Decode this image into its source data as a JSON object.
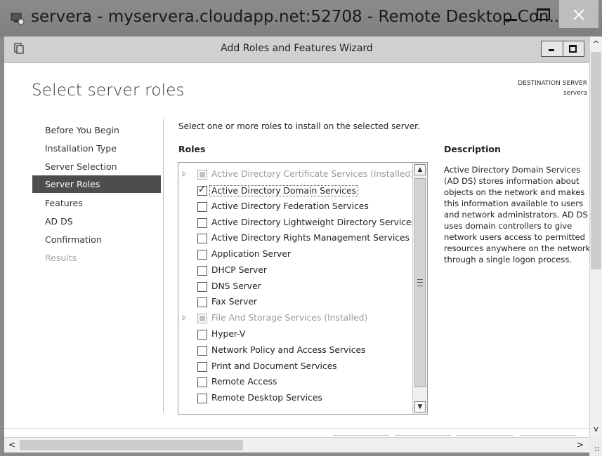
{
  "rdp": {
    "title": "servera - myservera.cloudapp.net:52708 - Remote Desktop Con..."
  },
  "wizard": {
    "title": "Add Roles and Features Wizard",
    "page_title": "Select server roles",
    "destination_label": "DESTINATION SERVER",
    "destination_value": "servera",
    "instruction": "Select one or more roles to install on the selected server.",
    "roles_heading": "Roles",
    "description_heading": "Description",
    "description": "Active Directory Domain Services (AD DS) stores information about objects on the network and makes this information available to users and network administrators. AD DS uses domain controllers to give network users access to permitted resources anywhere on the network through a single logon process."
  },
  "nav": [
    {
      "label": "Before You Begin",
      "state": "normal"
    },
    {
      "label": "Installation Type",
      "state": "normal"
    },
    {
      "label": "Server Selection",
      "state": "normal"
    },
    {
      "label": "Server Roles",
      "state": "active"
    },
    {
      "label": "Features",
      "state": "normal"
    },
    {
      "label": "AD DS",
      "state": "normal"
    },
    {
      "label": "Confirmation",
      "state": "normal"
    },
    {
      "label": "Results",
      "state": "disabled"
    }
  ],
  "roles": [
    {
      "label": "Active Directory Certificate Services (Installed)",
      "checked": false,
      "installed": true,
      "expandable": true
    },
    {
      "label": "Active Directory Domain Services",
      "checked": true,
      "installed": false,
      "expandable": false,
      "selected": true
    },
    {
      "label": "Active Directory Federation Services",
      "checked": false,
      "installed": false,
      "expandable": false
    },
    {
      "label": "Active Directory Lightweight Directory Services",
      "checked": false,
      "installed": false,
      "expandable": false
    },
    {
      "label": "Active Directory Rights Management Services",
      "checked": false,
      "installed": false,
      "expandable": false
    },
    {
      "label": "Application Server",
      "checked": false,
      "installed": false,
      "expandable": false
    },
    {
      "label": "DHCP Server",
      "checked": false,
      "installed": false,
      "expandable": false
    },
    {
      "label": "DNS Server",
      "checked": false,
      "installed": false,
      "expandable": false
    },
    {
      "label": "Fax Server",
      "checked": false,
      "installed": false,
      "expandable": false
    },
    {
      "label": "File And Storage Services (Installed)",
      "checked": false,
      "installed": true,
      "expandable": true
    },
    {
      "label": "Hyper-V",
      "checked": false,
      "installed": false,
      "expandable": false
    },
    {
      "label": "Network Policy and Access Services",
      "checked": false,
      "installed": false,
      "expandable": false
    },
    {
      "label": "Print and Document Services",
      "checked": false,
      "installed": false,
      "expandable": false
    },
    {
      "label": "Remote Access",
      "checked": false,
      "installed": false,
      "expandable": false
    },
    {
      "label": "Remote Desktop Services",
      "checked": false,
      "installed": false,
      "expandable": false
    }
  ],
  "colors": {
    "nav_active_bg": "#4d4d4d",
    "rdp_titlebar": "#8c8c8c",
    "close_button": "#bdbdbd",
    "disabled_text": "#9a9a9a"
  },
  "icons": {
    "rdp": "remote-desktop-icon",
    "wizard": "server-manager-icon",
    "scroll_up": "▲",
    "scroll_down": "▼",
    "scroll_left": "<",
    "scroll_right": ">",
    "up_chevron": "^",
    "down_chevron": "v"
  }
}
